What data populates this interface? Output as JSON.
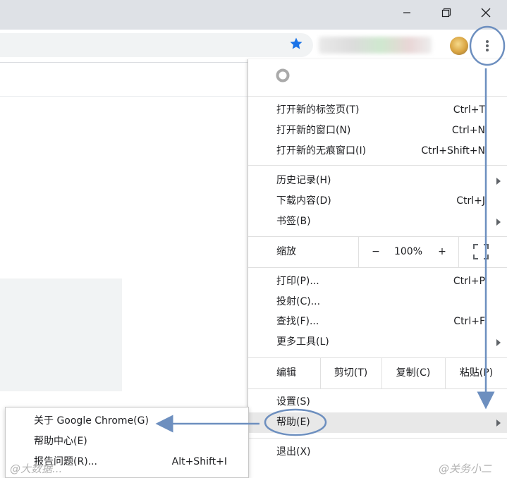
{
  "window": {
    "controls": [
      "minimize",
      "restore",
      "close"
    ]
  },
  "toolbar": {
    "bookmark_icon": "star-icon",
    "menu_icon": "three-dots-icon"
  },
  "menu": {
    "new_items": [
      {
        "label": "打开新的标签页(T)",
        "shortcut": "Ctrl+T"
      },
      {
        "label": "打开新的窗口(N)",
        "shortcut": "Ctrl+N"
      },
      {
        "label": "打开新的无痕窗口(I)",
        "shortcut": "Ctrl+Shift+N"
      }
    ],
    "history_items": [
      {
        "label": "历史记录(H)",
        "shortcut": ""
      },
      {
        "label": "下载内容(D)",
        "shortcut": "Ctrl+J"
      },
      {
        "label": "书签(B)",
        "shortcut": ""
      }
    ],
    "zoom": {
      "label": "缩放",
      "minus": "−",
      "value": "100%",
      "plus": "+"
    },
    "tool_items": [
      {
        "label": "打印(P)...",
        "shortcut": "Ctrl+P"
      },
      {
        "label": "投射(C)...",
        "shortcut": ""
      },
      {
        "label": "查找(F)...",
        "shortcut": "Ctrl+F"
      },
      {
        "label": "更多工具(L)",
        "shortcut": ""
      }
    ],
    "edit": {
      "label": "编辑",
      "cut": "剪切(T)",
      "copy": "复制(C)",
      "paste": "粘贴(P)"
    },
    "settings": {
      "label": "设置(S)"
    },
    "help": {
      "label": "帮助(E)"
    },
    "exit": {
      "label": "退出(X)"
    }
  },
  "help_submenu": [
    {
      "label": "关于 Google Chrome(G)",
      "shortcut": ""
    },
    {
      "label": "帮助中心(E)",
      "shortcut": ""
    },
    {
      "label": "报告问题(R)...",
      "shortcut": "Alt+Shift+I"
    }
  ],
  "watermarks": {
    "left": "@大数据...",
    "right": "@关务小二"
  },
  "colors": {
    "annotation": "#6d8fbf",
    "star": "#1a73e8",
    "highlight": "#e8e8e8"
  }
}
